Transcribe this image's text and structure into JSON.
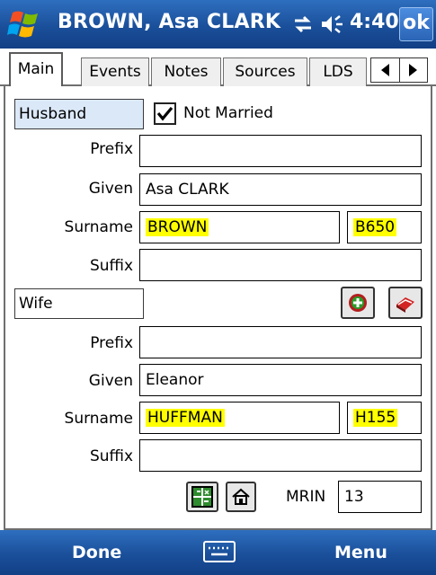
{
  "titlebar": {
    "title": "BROWN, Asa CLARK",
    "time": "4:40",
    "ok_label": "ok",
    "icons": [
      "windows-start-icon",
      "connectivity-icon",
      "volume-icon"
    ]
  },
  "tabs": [
    {
      "label": "Main",
      "active": true
    },
    {
      "label": "Events"
    },
    {
      "label": "Notes"
    },
    {
      "label": "Sources"
    },
    {
      "label": "LDS"
    }
  ],
  "husband": {
    "label": "Husband",
    "not_married_label": "Not Married",
    "not_married_checked": true,
    "prefix_label": "Prefix",
    "prefix": "",
    "given_label": "Given",
    "given": "Asa CLARK",
    "surname_label": "Surname",
    "surname": "BROWN",
    "soundex": "B650",
    "suffix_label": "Suffix",
    "suffix": ""
  },
  "wife": {
    "label": "Wife",
    "prefix_label": "Prefix",
    "prefix": "",
    "given_label": "Given",
    "given": "Eleanor",
    "surname_label": "Surname",
    "surname": "HUFFMAN",
    "soundex": "H155",
    "suffix_label": "Suffix",
    "suffix": ""
  },
  "mrin": {
    "label": "MRIN",
    "value": "13"
  },
  "bottombar": {
    "left": "Done",
    "right": "Menu"
  },
  "colors": {
    "titlebar": "#1a4f9a",
    "highlight": "#ffff00",
    "husband_bg": "#dbe8f8"
  }
}
